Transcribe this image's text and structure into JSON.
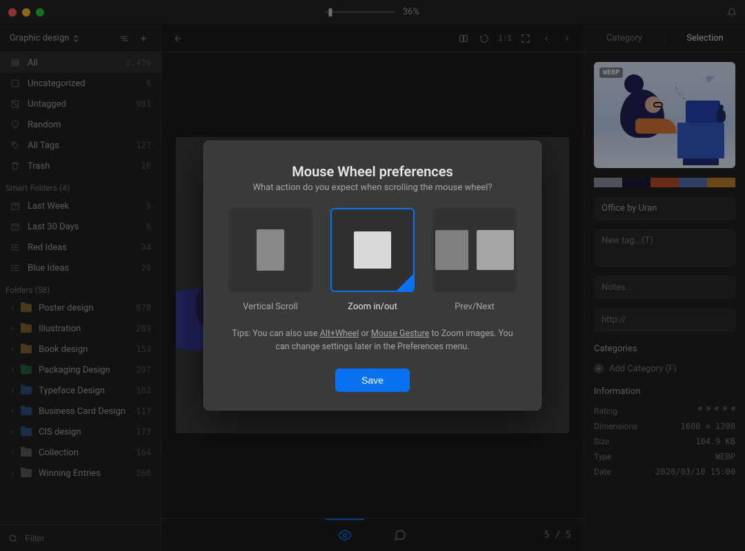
{
  "titlebar": {
    "zoom_percent": "36%"
  },
  "sidebar": {
    "library_name": "Graphic design",
    "filter_placeholder": "Filter",
    "system": [
      {
        "label": "All",
        "count": "2,436",
        "icon": "stack-icon",
        "selected": true
      },
      {
        "label": "Uncategorized",
        "count": "6",
        "icon": "box-icon"
      },
      {
        "label": "Untagged",
        "count": "981",
        "icon": "no-tag-icon"
      },
      {
        "label": "Random",
        "count": "",
        "icon": "bulb-icon"
      },
      {
        "label": "All Tags",
        "count": "127",
        "icon": "tag-icon"
      },
      {
        "label": "Trash",
        "count": "10",
        "icon": "trash-icon"
      }
    ],
    "smart_title": "Smart Folders (4)",
    "smart": [
      {
        "label": "Last Week",
        "count": "5",
        "icon": "calendar-7-icon"
      },
      {
        "label": "Last 30 Days",
        "count": "6",
        "icon": "calendar-31-icon"
      },
      {
        "label": "Red Ideas",
        "count": "34",
        "icon": "list-icon"
      },
      {
        "label": "Blue Ideas",
        "count": "29",
        "icon": "list-icon"
      }
    ],
    "folders_title": "Folders (58)",
    "folders": [
      {
        "label": "Poster design",
        "count": "878",
        "color": "#c79a3e"
      },
      {
        "label": "Illustration",
        "count": "283",
        "color": "#c79a3e"
      },
      {
        "label": "Book design",
        "count": "153",
        "color": "#c79a3e"
      },
      {
        "label": "Packaging Design",
        "count": "397",
        "color": "#2f8a4c"
      },
      {
        "label": "Typeface Design",
        "count": "102",
        "color": "#4272c4"
      },
      {
        "label": "Business Card Design",
        "count": "117",
        "color": "#4272c4"
      },
      {
        "label": "CIS design",
        "count": "173",
        "color": "#4272c4"
      },
      {
        "label": "Collection",
        "count": "164",
        "color": "#888888"
      },
      {
        "label": "Winning Entries",
        "count": "266",
        "color": "#888888"
      }
    ]
  },
  "viewer": {
    "ratio_label": "1:1",
    "footer_counter": "5 / 5"
  },
  "rightpanel": {
    "tabs": {
      "category": "Category",
      "selection": "Selection",
      "active": "selection"
    },
    "badge": "WEBP",
    "colors": [
      "#8d97a3",
      "#1b1b3a",
      "#c04d2a",
      "#5676b8",
      "#c5812f"
    ],
    "name": "Office by Uran",
    "tag_placeholder": "New tag...(T)",
    "notes_placeholder": "Notes...",
    "url_placeholder": "http://",
    "categories_heading": "Categories",
    "add_category_label": "Add Category (F)",
    "info_heading": "Information",
    "info": {
      "rating_label": "Rating",
      "dimensions_label": "Dimensions",
      "dimensions_value": "1600 × 1200",
      "size_label": "Size",
      "size_value": "104.9 KB",
      "type_label": "Type",
      "type_value": "WEBP",
      "date_label": "Date",
      "date_value": "2020/03/10 15:00"
    }
  },
  "modal": {
    "title": "Mouse Wheel preferences",
    "subtitle": "What action do you expect when scrolling the mouse wheel?",
    "options": {
      "vertical": "Vertical Scroll",
      "zoom": "Zoom in/out",
      "prevnext": "Prev/Next"
    },
    "selected": "zoom",
    "tip_prefix": "Tips: You can also use ",
    "tip_shortcut": "Alt+Wheel",
    "tip_or": " or ",
    "tip_link": "Mouse Gesture",
    "tip_suffix": " to Zoom images. You can change settings later in the Preferences menu.",
    "save": "Save"
  }
}
